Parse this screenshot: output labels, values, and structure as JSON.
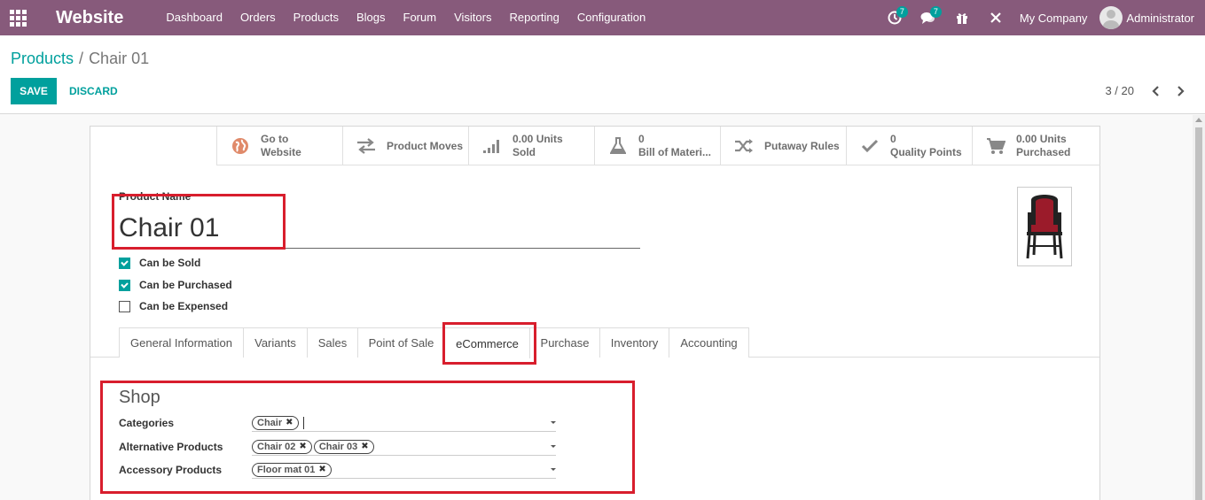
{
  "navbar": {
    "brand": "Website",
    "menu": [
      "Dashboard",
      "Orders",
      "Products",
      "Blogs",
      "Forum",
      "Visitors",
      "Reporting",
      "Configuration"
    ],
    "activity_count": "7",
    "message_count": "7",
    "company": "My Company",
    "user": "Administrator"
  },
  "breadcrumb": {
    "parent": "Products",
    "separator": "/",
    "current": "Chair 01"
  },
  "actions": {
    "save": "SAVE",
    "discard": "DISCARD"
  },
  "pager": {
    "text": "3 / 20"
  },
  "smart_buttons": [
    {
      "line1": "Go to",
      "line2": "Website",
      "icon": "globe-icon"
    },
    {
      "line1": "Product Moves",
      "line2": "",
      "icon": "arrows-exchange-icon"
    },
    {
      "line1": "0.00 Units",
      "line2": "Sold",
      "icon": "signal-bars-icon"
    },
    {
      "line1": "0",
      "line2": "Bill of Materi...",
      "icon": "flask-icon"
    },
    {
      "line1": "Putaway Rules",
      "line2": "",
      "icon": "random-icon"
    },
    {
      "line1": "0",
      "line2": "Quality Points",
      "icon": "check-icon"
    },
    {
      "line1": "0.00 Units",
      "line2": "Purchased",
      "icon": "cart-icon"
    }
  ],
  "form": {
    "name_label": "Product Name",
    "name_value": "Chair 01",
    "checkboxes": [
      {
        "label": "Can be Sold",
        "checked": true
      },
      {
        "label": "Can be Purchased",
        "checked": true
      },
      {
        "label": "Can be Expensed",
        "checked": false
      }
    ]
  },
  "tabs": [
    "General Information",
    "Variants",
    "Sales",
    "Point of Sale",
    "eCommerce",
    "Purchase",
    "Inventory",
    "Accounting"
  ],
  "active_tab": "eCommerce",
  "shop": {
    "title": "Shop",
    "fields": [
      {
        "label": "Categories",
        "tags": [
          "Chair"
        ]
      },
      {
        "label": "Alternative Products",
        "tags": [
          "Chair 02",
          "Chair 03"
        ]
      },
      {
        "label": "Accessory Products",
        "tags": [
          "Floor mat 01"
        ]
      }
    ]
  },
  "colors": {
    "navbar": "#875a7b",
    "primary": "#00a09d",
    "highlight": "#d81e2d"
  }
}
